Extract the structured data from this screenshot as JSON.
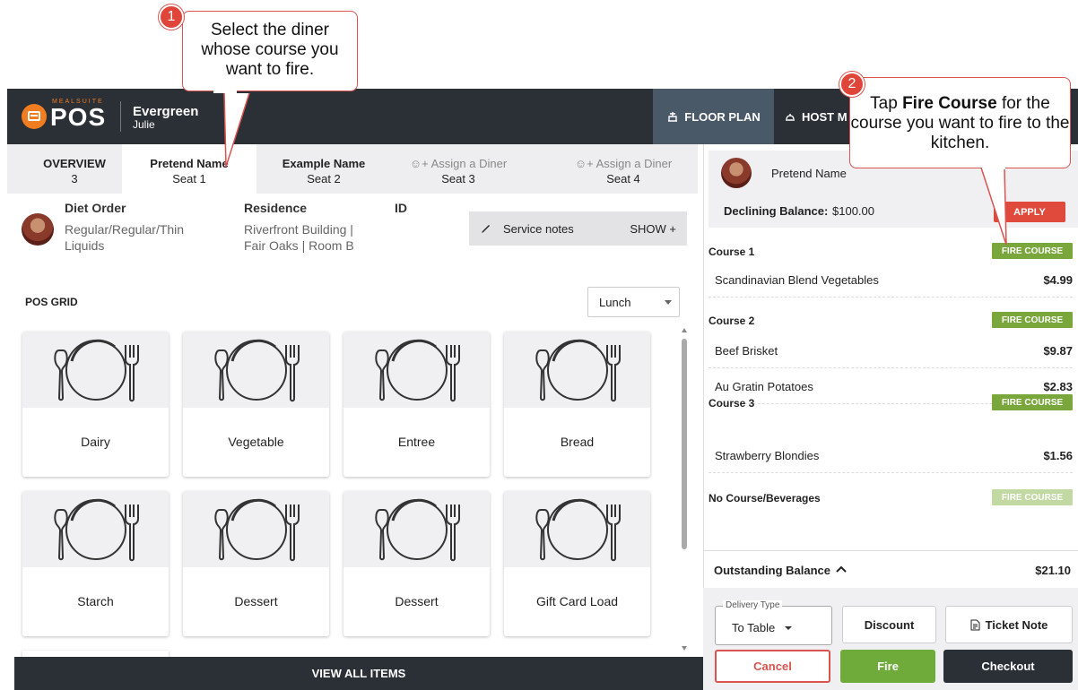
{
  "callouts": {
    "one": {
      "number": "1",
      "text": "Select the diner whose course you want to fire."
    },
    "two": {
      "number": "2",
      "text_pre": "Tap ",
      "text_bold": "Fire Course",
      "text_post": " for the course you want to fire to the kitchen."
    }
  },
  "appbar": {
    "brand_small": "MEALSUITE",
    "brand_big": "POS",
    "location": "Evergreen",
    "user": "Julie",
    "floor_plan": "FLOOR PLAN",
    "host_mode": "HOST M"
  },
  "tabs": [
    {
      "title": "OVERVIEW",
      "sub": "3"
    },
    {
      "title": "Pretend Name",
      "sub": "Seat 1"
    },
    {
      "title": "Example Name",
      "sub": "Seat 2"
    },
    {
      "title": "Assign a Diner",
      "sub": "Seat 3"
    },
    {
      "title": "Assign a Diner",
      "sub": "Seat 4"
    }
  ],
  "diner_info": {
    "diet_label": "Diet Order",
    "diet_value_1": "Regular/Regular/Thin",
    "diet_value_2": "Liquids",
    "residence_label": "Residence",
    "residence_value_1": "Riverfront Building |",
    "residence_value_2": "Fair Oaks | Room B",
    "id_label": "ID",
    "service_notes": "Service notes",
    "show": "SHOW"
  },
  "pos_grid": {
    "title": "POS GRID",
    "meal": "Lunch",
    "tiles": [
      "Dairy",
      "Vegetable",
      "Entree",
      "Bread",
      "Starch",
      "Dessert",
      "Dessert",
      "Gift Card Load"
    ],
    "view_all": "VIEW ALL ITEMS"
  },
  "order": {
    "diner_name": "Pretend Name",
    "balance_label": "Declining Balance:",
    "balance_value": "$100.00",
    "apply": "APPLY",
    "fire_course": "FIRE COURSE",
    "courses": [
      {
        "name": "Course 1",
        "items": [
          {
            "name": "Scandinavian Blend Vegetables",
            "price": "$4.99"
          }
        ]
      },
      {
        "name": "Course 2",
        "items": [
          {
            "name": "Beef Brisket",
            "price": "$9.87"
          },
          {
            "name": "Au Gratin Potatoes",
            "price": "$2.83"
          }
        ]
      },
      {
        "name": "Course 3",
        "items": [
          {
            "name": "Strawberry Blondies",
            "price": "$1.56"
          }
        ]
      },
      {
        "name": "No Course/Beverages",
        "items": []
      }
    ],
    "outstanding_label": "Outstanding Balance",
    "outstanding_value": "$21.10",
    "delivery_type_label": "Delivery Type",
    "delivery_type_value": "To Table",
    "discount": "Discount",
    "ticket_note": "Ticket Note",
    "cancel": "Cancel",
    "fire": "Fire",
    "checkout": "Checkout"
  },
  "colors": {
    "appbar": "#2b2f36",
    "brand_orange": "#f07d1f",
    "fire_green": "#7aa73c",
    "cancel_red": "#d9534f",
    "apply_red": "#e04a3c"
  }
}
